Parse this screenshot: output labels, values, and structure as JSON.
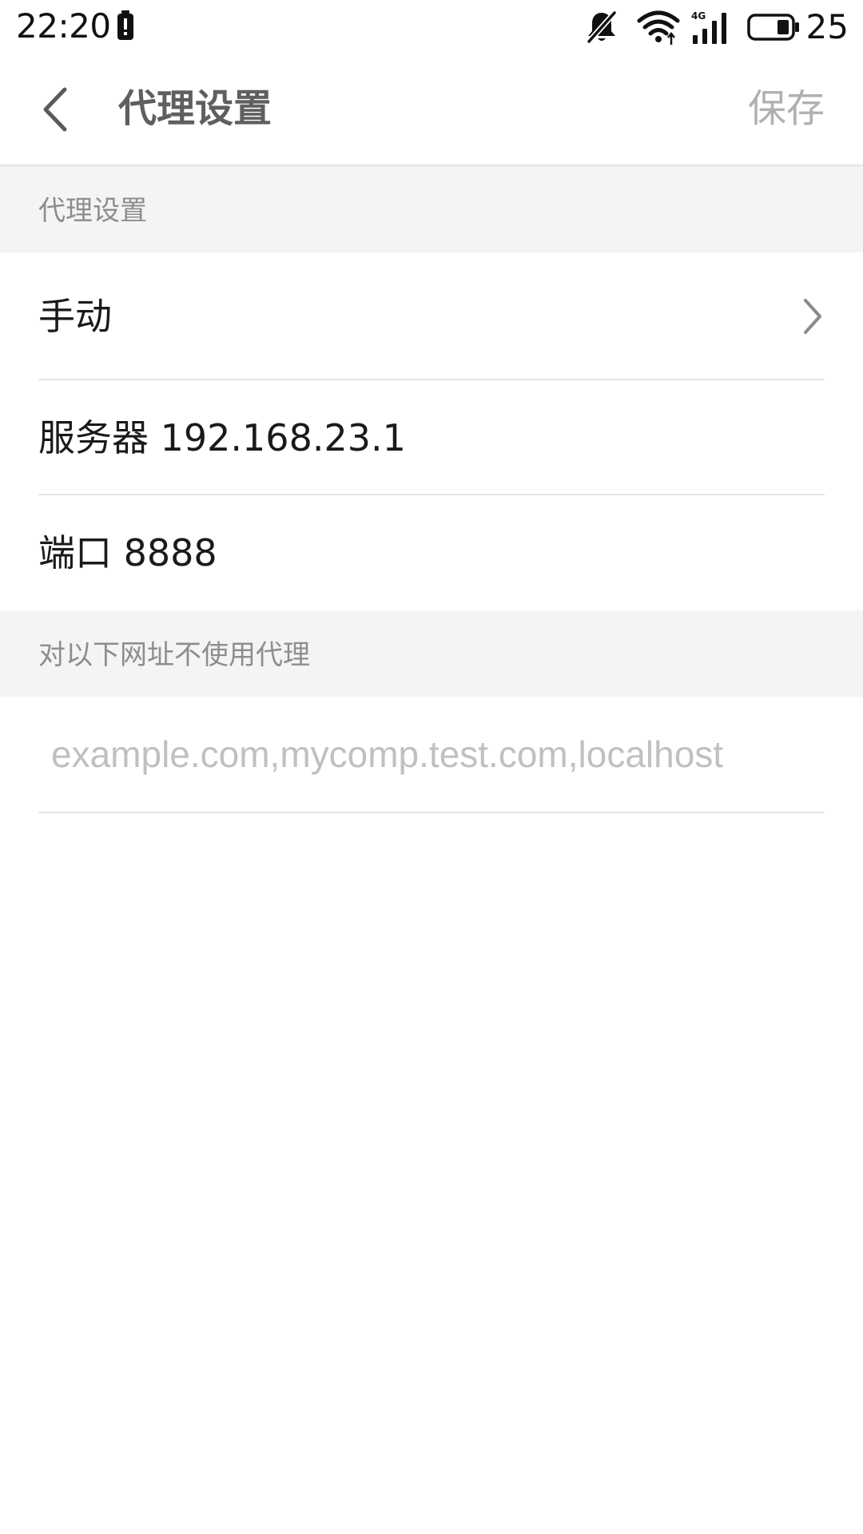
{
  "status_bar": {
    "time": "22:20",
    "battery_level": "25",
    "network_label": "4G",
    "icons": [
      "battery-alert-icon",
      "mute-icon",
      "wifi-icon",
      "cell-signal-icon",
      "battery-icon"
    ]
  },
  "toolbar": {
    "back_icon": "chevron-left-icon",
    "title": "代理设置",
    "save_label": "保存"
  },
  "sections": {
    "proxy": {
      "header": "代理设置",
      "mode_label": "手动",
      "server_label": "服务器 192.168.23.1",
      "port_label": "端口 8888"
    },
    "bypass": {
      "header": "对以下网址不使用代理",
      "input_value": "",
      "input_placeholder": "example.com,mycomp.test.com,localhost"
    }
  },
  "colors": {
    "background": "#ffffff",
    "section_background": "#f4f4f4",
    "divider": "#e4e4e4",
    "title_text": "#5f5f5f",
    "save_text": "#b0b0b0",
    "header_text": "#8d8d8d",
    "row_text": "#1a1a1a",
    "placeholder_text": "#c0c0c0"
  }
}
